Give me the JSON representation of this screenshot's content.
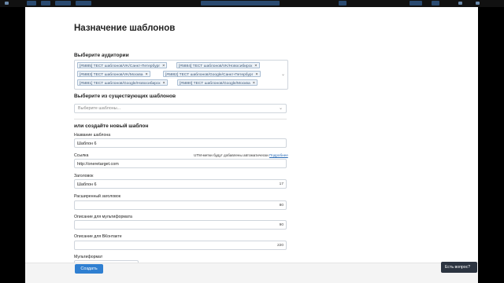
{
  "page": {
    "title": "Назначение шаблонов"
  },
  "audience": {
    "label": "Выберите аудитории",
    "tags": [
      "[#5885] ТЕСТ шаблонов/VK/Санкт-Петербург",
      "[#5884] ТЕСТ шаблонов/VK/Новосибирск",
      "[#5883] ТЕСТ шаблонов/VK/Москва",
      "[#5882] ТЕСТ шаблонов/Google/Санкт-Петербург",
      "[#5881] ТЕСТ шаблонов/Google/Новосибирск",
      "[#5880] ТЕСТ шаблонов/Google/Москва"
    ]
  },
  "existing": {
    "label": "Выберите из существующих шаблонов",
    "placeholder": "Выберите шаблоны..."
  },
  "new_template": {
    "heading": "или создайте новый шаблон",
    "name_label": "Название шаблона",
    "name_value": "Шаблон 6",
    "link_label": "Ссылка",
    "utm_note": "UTM-метки будут добавлены автоматически",
    "utm_link": "Подробнее",
    "link_value": "http://oneretarget.com",
    "title_label": "Заголовок",
    "title_value": "Шаблон 6",
    "title_counter": "17",
    "ext_title_label": "Расширенный заголовок",
    "ext_title_counter": "80",
    "multiformat_desc_label": "Описание для мультиформата",
    "multiformat_desc_counter": "90",
    "vk_desc_label": "Описание для ВКонтакте",
    "vk_desc_counter": "220",
    "multiformat_label": "Мультиформат"
  },
  "footer": {
    "create_label": "Создать"
  },
  "help": {
    "label": "Есть вопрос?"
  },
  "colors": {
    "accent": "#2f7fd1",
    "tag_bg": "#eef3f8",
    "help_bg": "#2c3440"
  },
  "icons": {
    "chat": "chat-bubble-icon",
    "caret": "chevron-down-icon",
    "remove": "close-icon"
  }
}
